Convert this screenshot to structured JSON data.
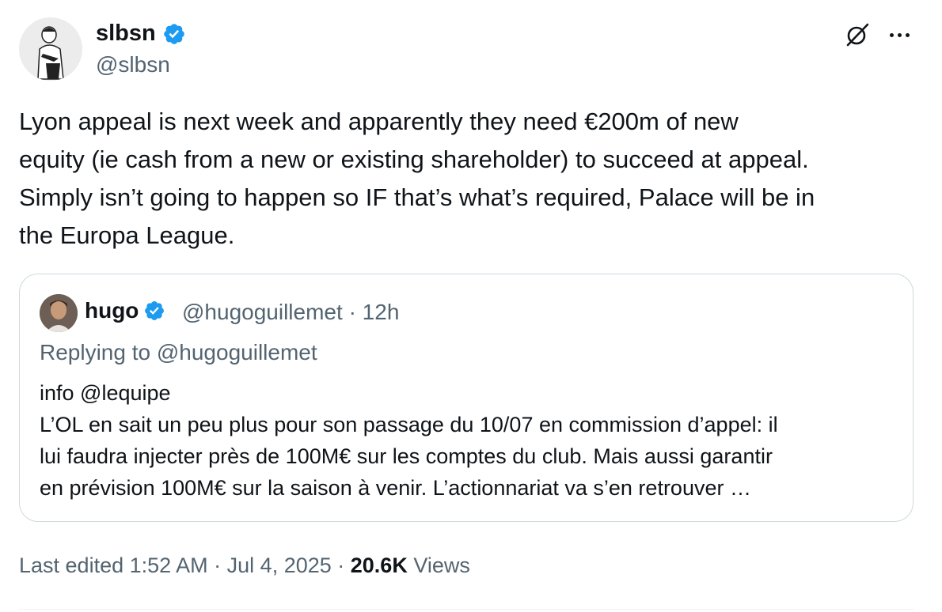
{
  "author": {
    "name": "slbsn",
    "handle": "@slbsn",
    "verified_color": "#1d9bf0"
  },
  "tweet": {
    "text": "Lyon appeal is next week and apparently they need €200m of new\nequity (ie cash from a new or existing shareholder) to succeed at appeal.\nSimply isn’t going to happen so IF that’s what’s required, Palace will be in\nthe Europa League."
  },
  "icons": {
    "grok": "grok-icon",
    "more": "more-icon"
  },
  "quote": {
    "name": "hugo",
    "handle": "@hugoguillemet",
    "separator": "·",
    "time": "12h",
    "replying_to": "Replying to @hugoguillemet",
    "text": "info @lequipe\nL’OL en sait un peu plus pour son passage du 10/07 en commission d’appel: il\nlui faudra injecter près de 100M€ sur les comptes du club. Mais aussi garantir\nen prévision 100M€ sur la saison à venir. L’actionnariat va s’en retrouver …"
  },
  "footer": {
    "edited": "Last edited 1:52 AM · Jul 4, 2025 · ",
    "views_count": "20.6K",
    "views_label": " Views"
  }
}
